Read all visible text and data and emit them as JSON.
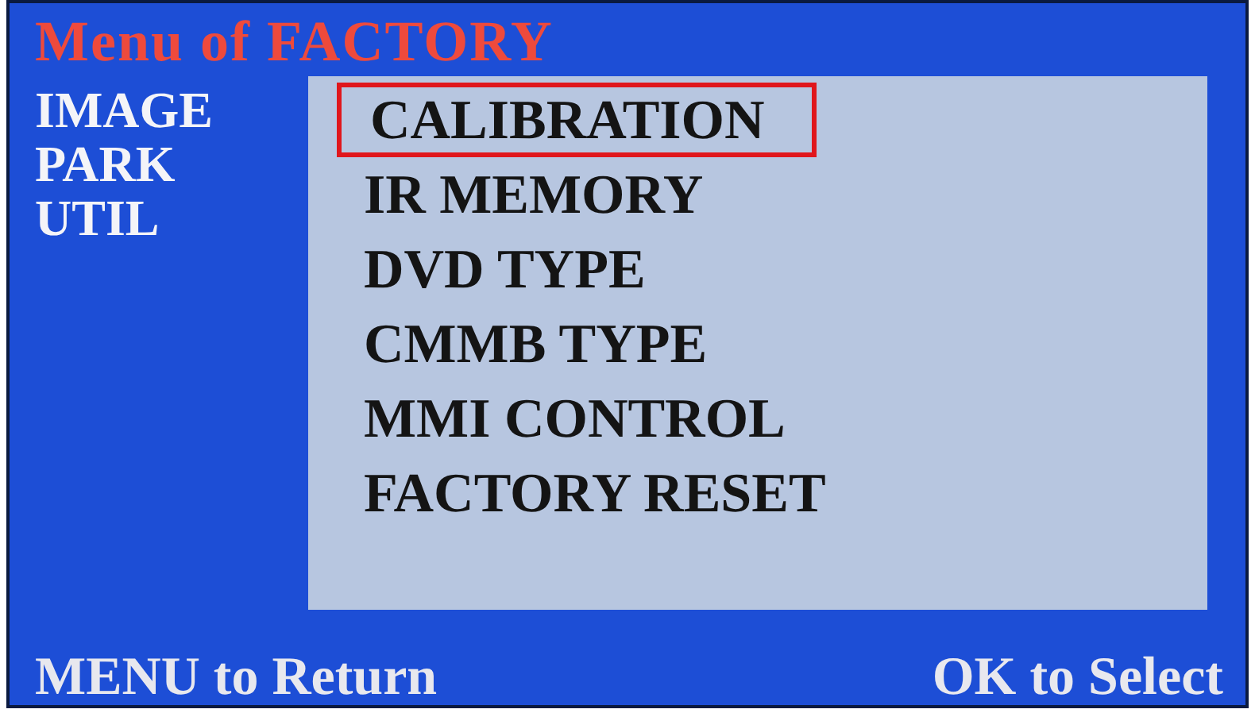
{
  "title": "Menu of FACTORY",
  "categories": [
    "IMAGE",
    "PARK",
    "UTIL"
  ],
  "items": [
    {
      "label": "CALIBRATION",
      "selected": true
    },
    {
      "label": "IR MEMORY",
      "selected": false
    },
    {
      "label": "DVD TYPE",
      "selected": false
    },
    {
      "label": "CMMB TYPE",
      "selected": false
    },
    {
      "label": "MMI CONTROL",
      "selected": false
    },
    {
      "label": "FACTORY RESET",
      "selected": false
    }
  ],
  "footer": {
    "back": "MENU to Return",
    "select": "OK to Select"
  }
}
